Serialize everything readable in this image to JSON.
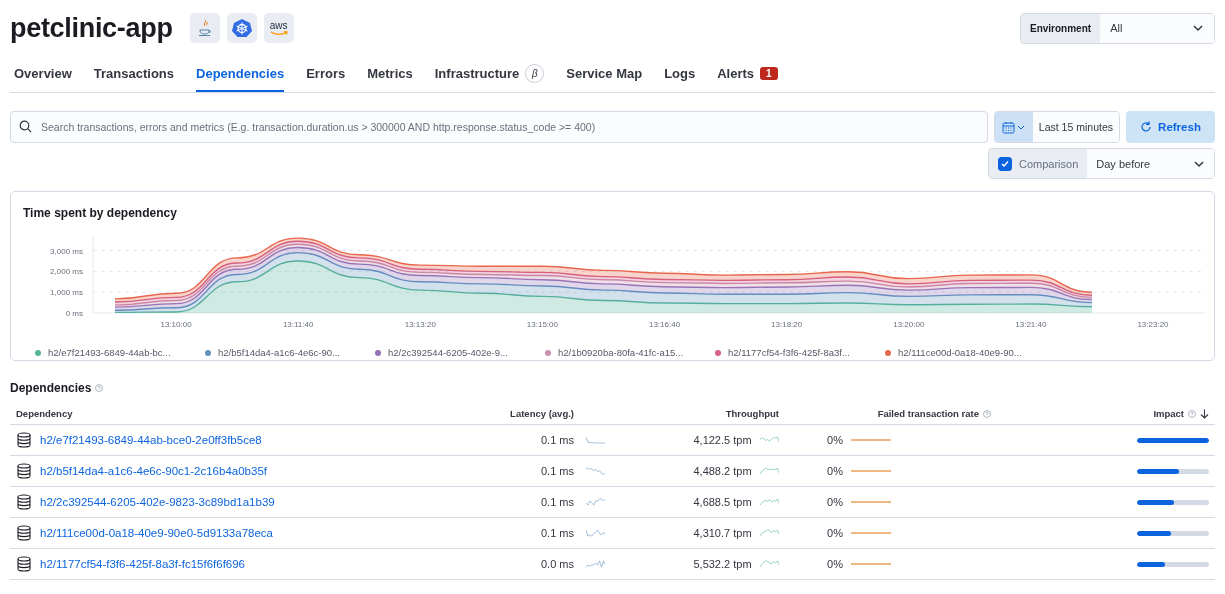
{
  "title": "petclinic-app",
  "badges": [
    {
      "kind": "java"
    },
    {
      "kind": "kubernetes"
    },
    {
      "kind": "aws",
      "label": "aws"
    }
  ],
  "environment": {
    "label": "Environment",
    "value": "All"
  },
  "tabs": [
    {
      "label": "Overview",
      "selected": false
    },
    {
      "label": "Transactions",
      "selected": false
    },
    {
      "label": "Dependencies",
      "selected": true
    },
    {
      "label": "Errors",
      "selected": false
    },
    {
      "label": "Metrics",
      "selected": false
    },
    {
      "label": "Infrastructure",
      "selected": false,
      "beta": "β"
    },
    {
      "label": "Service Map",
      "selected": false
    },
    {
      "label": "Logs",
      "selected": false
    },
    {
      "label": "Alerts",
      "selected": false,
      "count": "1"
    }
  ],
  "search": {
    "placeholder": "Search transactions, errors and metrics (E.g. transaction.duration.us > 300000 AND http.response.status_code >= 400)"
  },
  "time_range": "Last 15 minutes",
  "refresh": "Refresh",
  "comparison": {
    "label": "Comparison",
    "checked": true,
    "value": "Day before"
  },
  "chart_panel": {
    "title": "Time spent by dependency",
    "chart_data": {
      "type": "area",
      "stacked": true,
      "categories": [
        null,
        "13:10:00",
        null,
        "13:11:40",
        null,
        "13:13:20",
        null,
        "13:15:00",
        null,
        "13:16:40",
        null,
        "13:18:20",
        null,
        "13:20:00",
        null,
        "13:21:40",
        null,
        "13:23:20"
      ],
      "grid": true,
      "ylim": [
        0,
        3700
      ],
      "yticks": [
        {
          "value": 0,
          "label": "0 ms"
        },
        {
          "value": 1000,
          "label": "1,000 ms"
        },
        {
          "value": 2000,
          "label": "2,000 ms"
        },
        {
          "value": 3000,
          "label": "3,000 ms"
        }
      ],
      "series": [
        {
          "name": "h2/e7f21493-6849-44ab-bc...",
          "color": "#54b399",
          "values": [
            30,
            50,
            1500,
            2500,
            1700,
            1100,
            950,
            800,
            600,
            480,
            450,
            450,
            480,
            400,
            420,
            430,
            300,
            null
          ]
        },
        {
          "name": "h2/b5f14da4-a1c6-4e6c-90...",
          "color": "#6092c0",
          "values": [
            100,
            200,
            350,
            400,
            400,
            400,
            450,
            500,
            500,
            480,
            450,
            450,
            500,
            400,
            450,
            450,
            200,
            null
          ]
        },
        {
          "name": "h2/2c392544-6205-402e-9...",
          "color": "#9170b8",
          "values": [
            150,
            200,
            250,
            250,
            250,
            300,
            300,
            300,
            300,
            300,
            320,
            350,
            350,
            300,
            350,
            350,
            150,
            null
          ]
        },
        {
          "name": "h2/1b0920ba-80fa-41fc-a15...",
          "color": "#ca8eae",
          "values": [
            100,
            150,
            150,
            150,
            150,
            150,
            150,
            200,
            200,
            200,
            200,
            200,
            200,
            150,
            200,
            200,
            100,
            null
          ]
        },
        {
          "name": "h2/1177cf54-f3f6-425f-8a3f...",
          "color": "#d36086",
          "values": [
            150,
            150,
            150,
            150,
            150,
            150,
            150,
            150,
            150,
            150,
            150,
            150,
            200,
            150,
            150,
            150,
            100,
            null
          ]
        },
        {
          "name": "h2/111ce00d-0a18-40e9-90...",
          "color": "#e7664c",
          "values": [
            150,
            200,
            250,
            150,
            150,
            200,
            250,
            300,
            300,
            300,
            250,
            250,
            250,
            250,
            250,
            250,
            150,
            null
          ]
        }
      ]
    }
  },
  "table": {
    "title": "Dependencies",
    "columns": [
      "Dependency",
      "Latency (avg.)",
      "Throughput",
      "Failed transaction rate",
      "Impact"
    ],
    "rows": [
      {
        "name": "h2/e7f21493-6849-44ab-bce0-2e0ff3fb5ce8",
        "latency": "0.1 ms",
        "throughput": "4,122.5 tpm",
        "failed": "0%",
        "level": 1
      },
      {
        "name": "h2/b5f14da4-a1c6-4e6c-90c1-2c16b4a0b35f",
        "latency": "0.1 ms",
        "throughput": "4,488.2 tpm",
        "failed": "0%",
        "level": 0.58
      },
      {
        "name": "h2/2c392544-6205-402e-9823-3c89bd1a1b39",
        "latency": "0.1 ms",
        "throughput": "4,688.5 tpm",
        "failed": "0%",
        "level": 0.51
      },
      {
        "name": "h2/111ce00d-0a18-40e9-90e0-5d9133a78eca",
        "latency": "0.1 ms",
        "throughput": "4,310.7 tpm",
        "failed": "0%",
        "level": 0.47
      },
      {
        "name": "h2/1177cf54-f3f6-425f-8a3f-fc15f6f6f696",
        "latency": "0.0 ms",
        "throughput": "5,532.2 tpm",
        "failed": "0%",
        "level": 0.39
      }
    ]
  }
}
